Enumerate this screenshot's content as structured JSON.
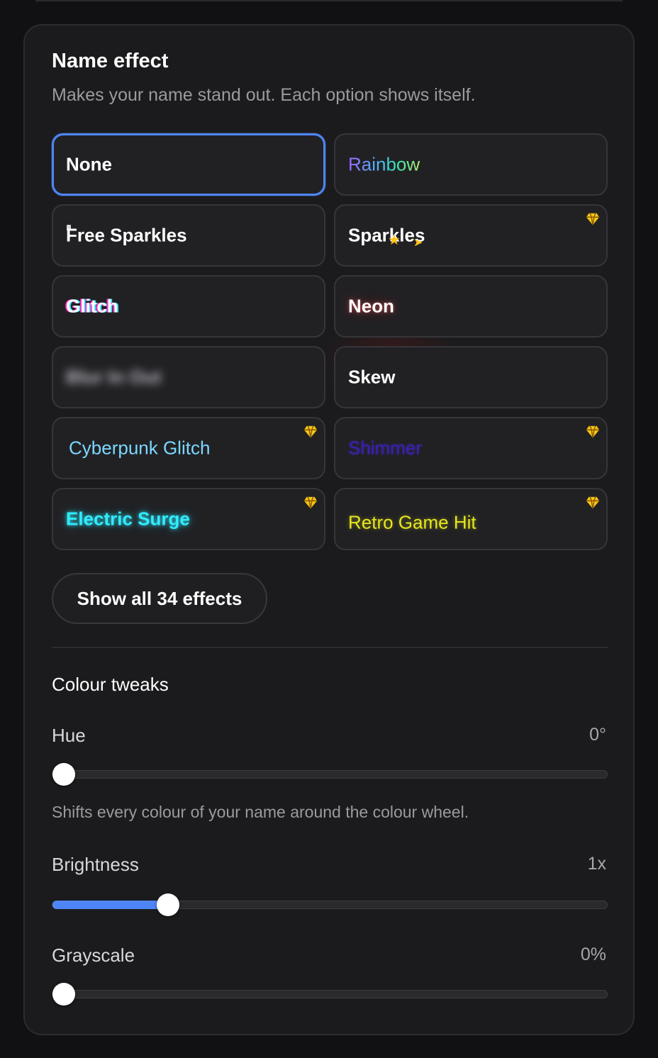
{
  "header": {
    "title": "Name effect",
    "subtitle": "Makes your name stand out. Each option shows itself."
  },
  "effects": [
    {
      "label": "None",
      "selected": true,
      "premium": false,
      "style": "plain"
    },
    {
      "label": "Rainbow",
      "selected": false,
      "premium": false,
      "style": "rainbow"
    },
    {
      "label": "Free Sparkles",
      "selected": false,
      "premium": false,
      "style": "plain"
    },
    {
      "label": "Sparkles",
      "selected": false,
      "premium": true,
      "style": "sparkles"
    },
    {
      "label": "Glitch",
      "selected": false,
      "premium": false,
      "style": "glitch"
    },
    {
      "label": "Neon",
      "selected": false,
      "premium": false,
      "style": "neon"
    },
    {
      "label": "Blur In Out",
      "selected": false,
      "premium": false,
      "style": "blur"
    },
    {
      "label": "Skew",
      "selected": false,
      "premium": false,
      "style": "plain"
    },
    {
      "label": "Cyberpunk Glitch",
      "selected": false,
      "premium": true,
      "style": "cyber"
    },
    {
      "label": "Shimmer",
      "selected": false,
      "premium": true,
      "style": "shimmer"
    },
    {
      "label": "Electric Surge",
      "selected": false,
      "premium": true,
      "style": "electric"
    },
    {
      "label": "Retro Game Hit",
      "selected": false,
      "premium": true,
      "style": "retro"
    }
  ],
  "show_all_label": "Show all 34 effects",
  "colour_tweaks": {
    "title": "Colour tweaks",
    "hue": {
      "label": "Hue",
      "value_text": "0°",
      "fraction": 0.0
    },
    "hue_hint": "Shifts every colour of your name around the colour wheel.",
    "brightness": {
      "label": "Brightness",
      "value_text": "1x",
      "fraction": 0.196
    },
    "grayscale": {
      "label": "Grayscale",
      "value_text": "0%",
      "fraction": 0.0
    }
  },
  "colors": {
    "accent": "#4f86f7",
    "premium_gem": "#f5c518",
    "panel_bg": "#1b1b1d",
    "page_bg": "#111113"
  },
  "icons": {
    "premium": "diamond-gem-icon",
    "sparkle": "star-sparkle-icon"
  }
}
